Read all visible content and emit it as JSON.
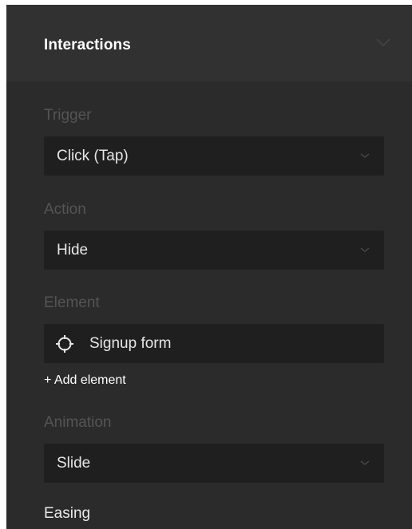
{
  "panel": {
    "title": "Interactions",
    "collapse_icon": "chevron-down-icon"
  },
  "trigger": {
    "label": "Trigger",
    "value": "Click (Tap)"
  },
  "action": {
    "label": "Action",
    "value": "Hide"
  },
  "element": {
    "label": "Element",
    "value": "Signup form",
    "icon": "target-icon",
    "add_label": "+ Add element"
  },
  "animation": {
    "label": "Animation",
    "value": "Slide"
  },
  "easing": {
    "label": "Easing"
  },
  "colors": {
    "panel_bg": "#2b2b2b",
    "header_bg": "#313131",
    "field_bg": "#1f1f1f",
    "muted_label": "#545454"
  }
}
